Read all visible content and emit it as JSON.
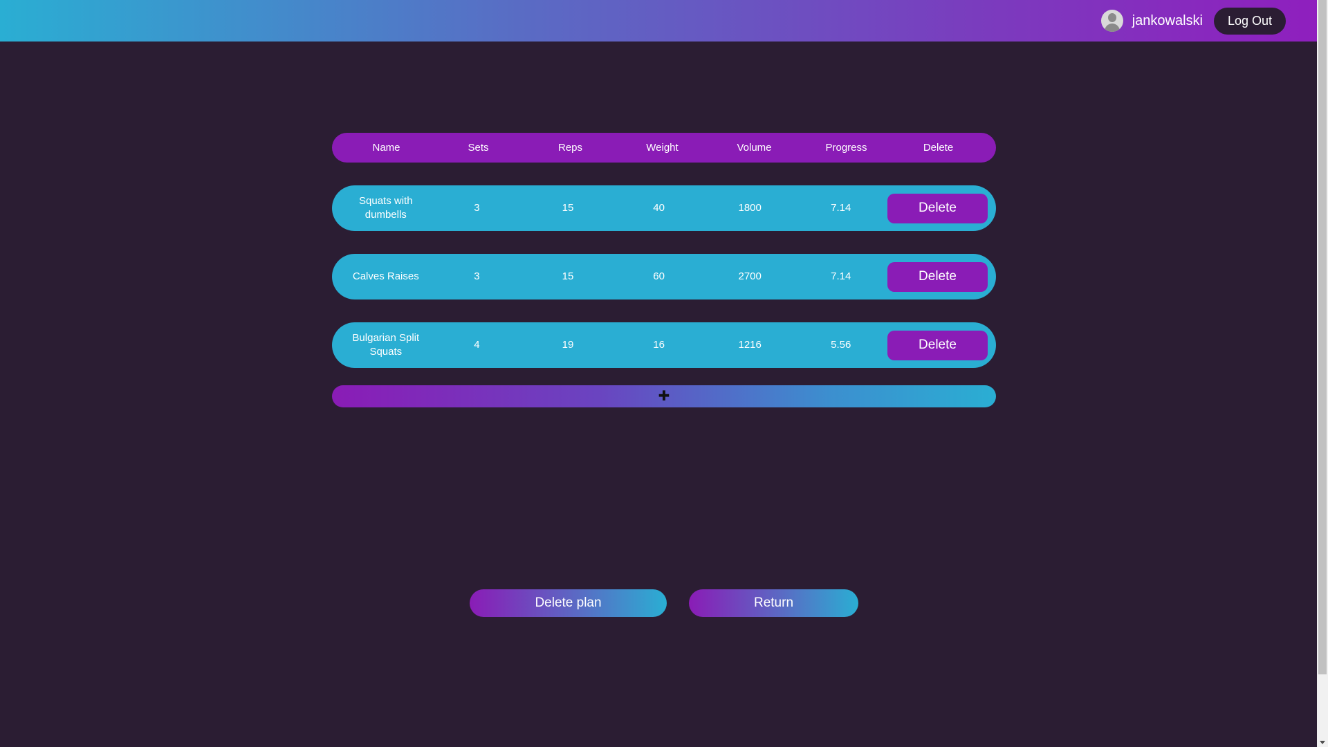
{
  "header": {
    "username": "jankowalski",
    "logout_label": "Log Out"
  },
  "table": {
    "columns": [
      "Name",
      "Sets",
      "Reps",
      "Weight",
      "Volume",
      "Progress",
      "Delete"
    ],
    "rows": [
      {
        "name": "Squats with dumbells",
        "sets": "3",
        "reps": "15",
        "weight": "40",
        "volume": "1800",
        "progress": "7.14",
        "delete_label": "Delete"
      },
      {
        "name": "Calves Raises",
        "sets": "3",
        "reps": "15",
        "weight": "60",
        "volume": "2700",
        "progress": "7.14",
        "delete_label": "Delete"
      },
      {
        "name": "Bulgarian Split Squats",
        "sets": "4",
        "reps": "19",
        "weight": "16",
        "volume": "1216",
        "progress": "5.56",
        "delete_label": "Delete"
      }
    ],
    "add_symbol": "✚"
  },
  "actions": {
    "delete_plan_label": "Delete plan",
    "return_label": "Return"
  },
  "icons": {
    "avatar": "user-avatar-icon",
    "add": "plus-icon"
  },
  "colors": {
    "background": "#2b1d33",
    "accent_purple": "#8a1cb6",
    "accent_cyan": "#2aaed3"
  }
}
